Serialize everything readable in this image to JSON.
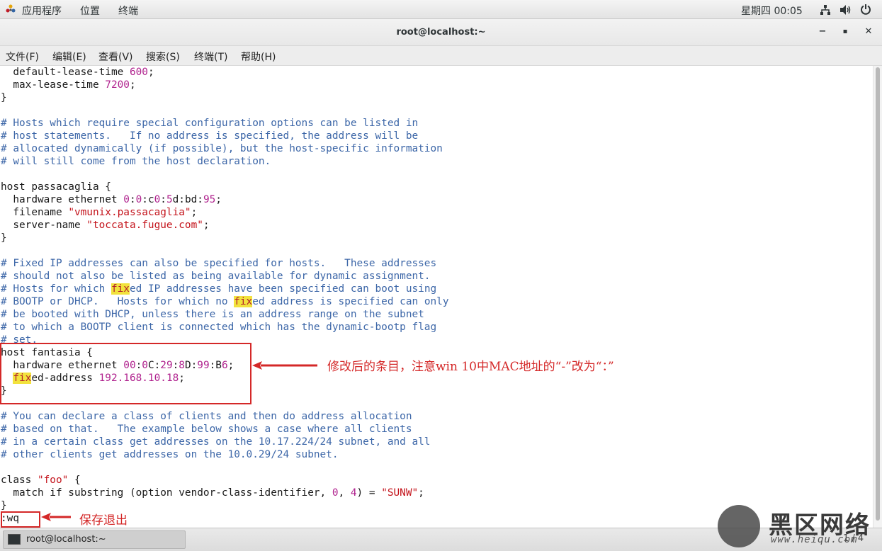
{
  "topbar": {
    "applications": "应用程序",
    "places": "位置",
    "terminal": "终端",
    "clock": "星期四 00:05"
  },
  "window": {
    "title": "root@localhost:~",
    "minimize": "−",
    "maximize": "▪",
    "close": "✕"
  },
  "menubar": {
    "items": [
      "文件(F)",
      "编辑(E)",
      "查看(V)",
      "搜索(S)",
      "终端(T)",
      "帮助(H)"
    ]
  },
  "terminal_lines": [
    [
      {
        "t": "  default-lease-time "
      },
      {
        "t": "600",
        "c": "n"
      },
      {
        "t": ";"
      }
    ],
    [
      {
        "t": "  max-lease-time "
      },
      {
        "t": "7200",
        "c": "n"
      },
      {
        "t": ";"
      }
    ],
    [
      {
        "t": "}"
      }
    ],
    [
      {
        "t": ""
      }
    ],
    [
      {
        "t": "# Hosts which require special configuration options can be listed in",
        "c": "c"
      }
    ],
    [
      {
        "t": "# host statements.   If no address is specified, the address will be",
        "c": "c"
      }
    ],
    [
      {
        "t": "# allocated dynamically (if possible), but the host-specific information",
        "c": "c"
      }
    ],
    [
      {
        "t": "# will still come from the host declaration.",
        "c": "c"
      }
    ],
    [
      {
        "t": ""
      }
    ],
    [
      {
        "t": "host passacaglia {"
      }
    ],
    [
      {
        "t": "  hardware ethernet "
      },
      {
        "t": "0",
        "c": "n"
      },
      {
        "t": ":"
      },
      {
        "t": "0",
        "c": "n"
      },
      {
        "t": ":c"
      },
      {
        "t": "0",
        "c": "n"
      },
      {
        "t": ":"
      },
      {
        "t": "5",
        "c": "n"
      },
      {
        "t": "d:bd:"
      },
      {
        "t": "95",
        "c": "n"
      },
      {
        "t": ";"
      }
    ],
    [
      {
        "t": "  filename "
      },
      {
        "t": "\"vmunix.passacaglia\"",
        "c": "s"
      },
      {
        "t": ";"
      }
    ],
    [
      {
        "t": "  server-name "
      },
      {
        "t": "\"toccata.fugue.com\"",
        "c": "s"
      },
      {
        "t": ";"
      }
    ],
    [
      {
        "t": "}"
      }
    ],
    [
      {
        "t": ""
      }
    ],
    [
      {
        "t": "# Fixed IP addresses can also be specified for hosts.   These addresses",
        "c": "c"
      }
    ],
    [
      {
        "t": "# should not also be listed as being available for dynamic assignment.",
        "c": "c"
      }
    ],
    [
      {
        "t": "# Hosts for which ",
        "c": "c"
      },
      {
        "t": "fix",
        "c": "hl"
      },
      {
        "t": "ed IP addresses have been specified can boot using",
        "c": "c"
      }
    ],
    [
      {
        "t": "# BOOTP or DHCP.   Hosts for which no ",
        "c": "c"
      },
      {
        "t": "fix",
        "c": "hl"
      },
      {
        "t": "ed address is specified can only",
        "c": "c"
      }
    ],
    [
      {
        "t": "# be booted with DHCP, unless there is an address range on the subnet",
        "c": "c"
      }
    ],
    [
      {
        "t": "# to which a BOOTP client is connected which has the dynamic-bootp flag",
        "c": "c"
      }
    ],
    [
      {
        "t": "# set.",
        "c": "c"
      }
    ],
    [
      {
        "t": "host fantasia {"
      }
    ],
    [
      {
        "t": "  hardware ethernet "
      },
      {
        "t": "00",
        "c": "n"
      },
      {
        "t": ":"
      },
      {
        "t": "0",
        "c": "n"
      },
      {
        "t": "C:"
      },
      {
        "t": "29",
        "c": "n"
      },
      {
        "t": ":"
      },
      {
        "t": "8",
        "c": "n"
      },
      {
        "t": "D:"
      },
      {
        "t": "99",
        "c": "n"
      },
      {
        "t": ":B"
      },
      {
        "t": "6",
        "c": "n"
      },
      {
        "t": ";"
      }
    ],
    [
      {
        "t": "  "
      },
      {
        "t": "fix",
        "c": "hl"
      },
      {
        "t": "ed-address "
      },
      {
        "t": "192.168.10.18",
        "c": "n"
      },
      {
        "t": ";"
      }
    ],
    [
      {
        "t": "}"
      }
    ],
    [
      {
        "t": ""
      }
    ],
    [
      {
        "t": "# You can declare a class of clients and then do address allocation",
        "c": "c"
      }
    ],
    [
      {
        "t": "# based on that.   The example below shows a case where all clients",
        "c": "c"
      }
    ],
    [
      {
        "t": "# in a certain class get addresses on the 10.17.224/24 subnet, and all",
        "c": "c"
      }
    ],
    [
      {
        "t": "# other clients get addresses on the 10.0.29/24 subnet.",
        "c": "c"
      }
    ],
    [
      {
        "t": ""
      }
    ],
    [
      {
        "t": "class "
      },
      {
        "t": "\"foo\"",
        "c": "s"
      },
      {
        "t": " {"
      }
    ],
    [
      {
        "t": "  match if substring (option vendor-class-identifier, "
      },
      {
        "t": "0",
        "c": "n"
      },
      {
        "t": ", "
      },
      {
        "t": "4",
        "c": "n"
      },
      {
        "t": ") = "
      },
      {
        "t": "\"SUNW\"",
        "c": "s"
      },
      {
        "t": ";"
      }
    ],
    [
      {
        "t": "}"
      }
    ],
    [
      {
        "t": ":wq"
      }
    ]
  ],
  "annotations": {
    "modified_entry": "修改后的条目，注意win 10中MAC地址的“-”改为“：”",
    "save_exit": "保存退出"
  },
  "taskbar": {
    "task_label": "root@localhost:~",
    "pager": "1 / 4"
  },
  "watermark": {
    "text": "黑区网络",
    "url": "www.heiqu.com"
  },
  "colors": {
    "comment": "#3d67a8",
    "string": "#c4141c",
    "number": "#b0228e",
    "highlight": "#f2e23d",
    "annotation": "#d42828"
  }
}
